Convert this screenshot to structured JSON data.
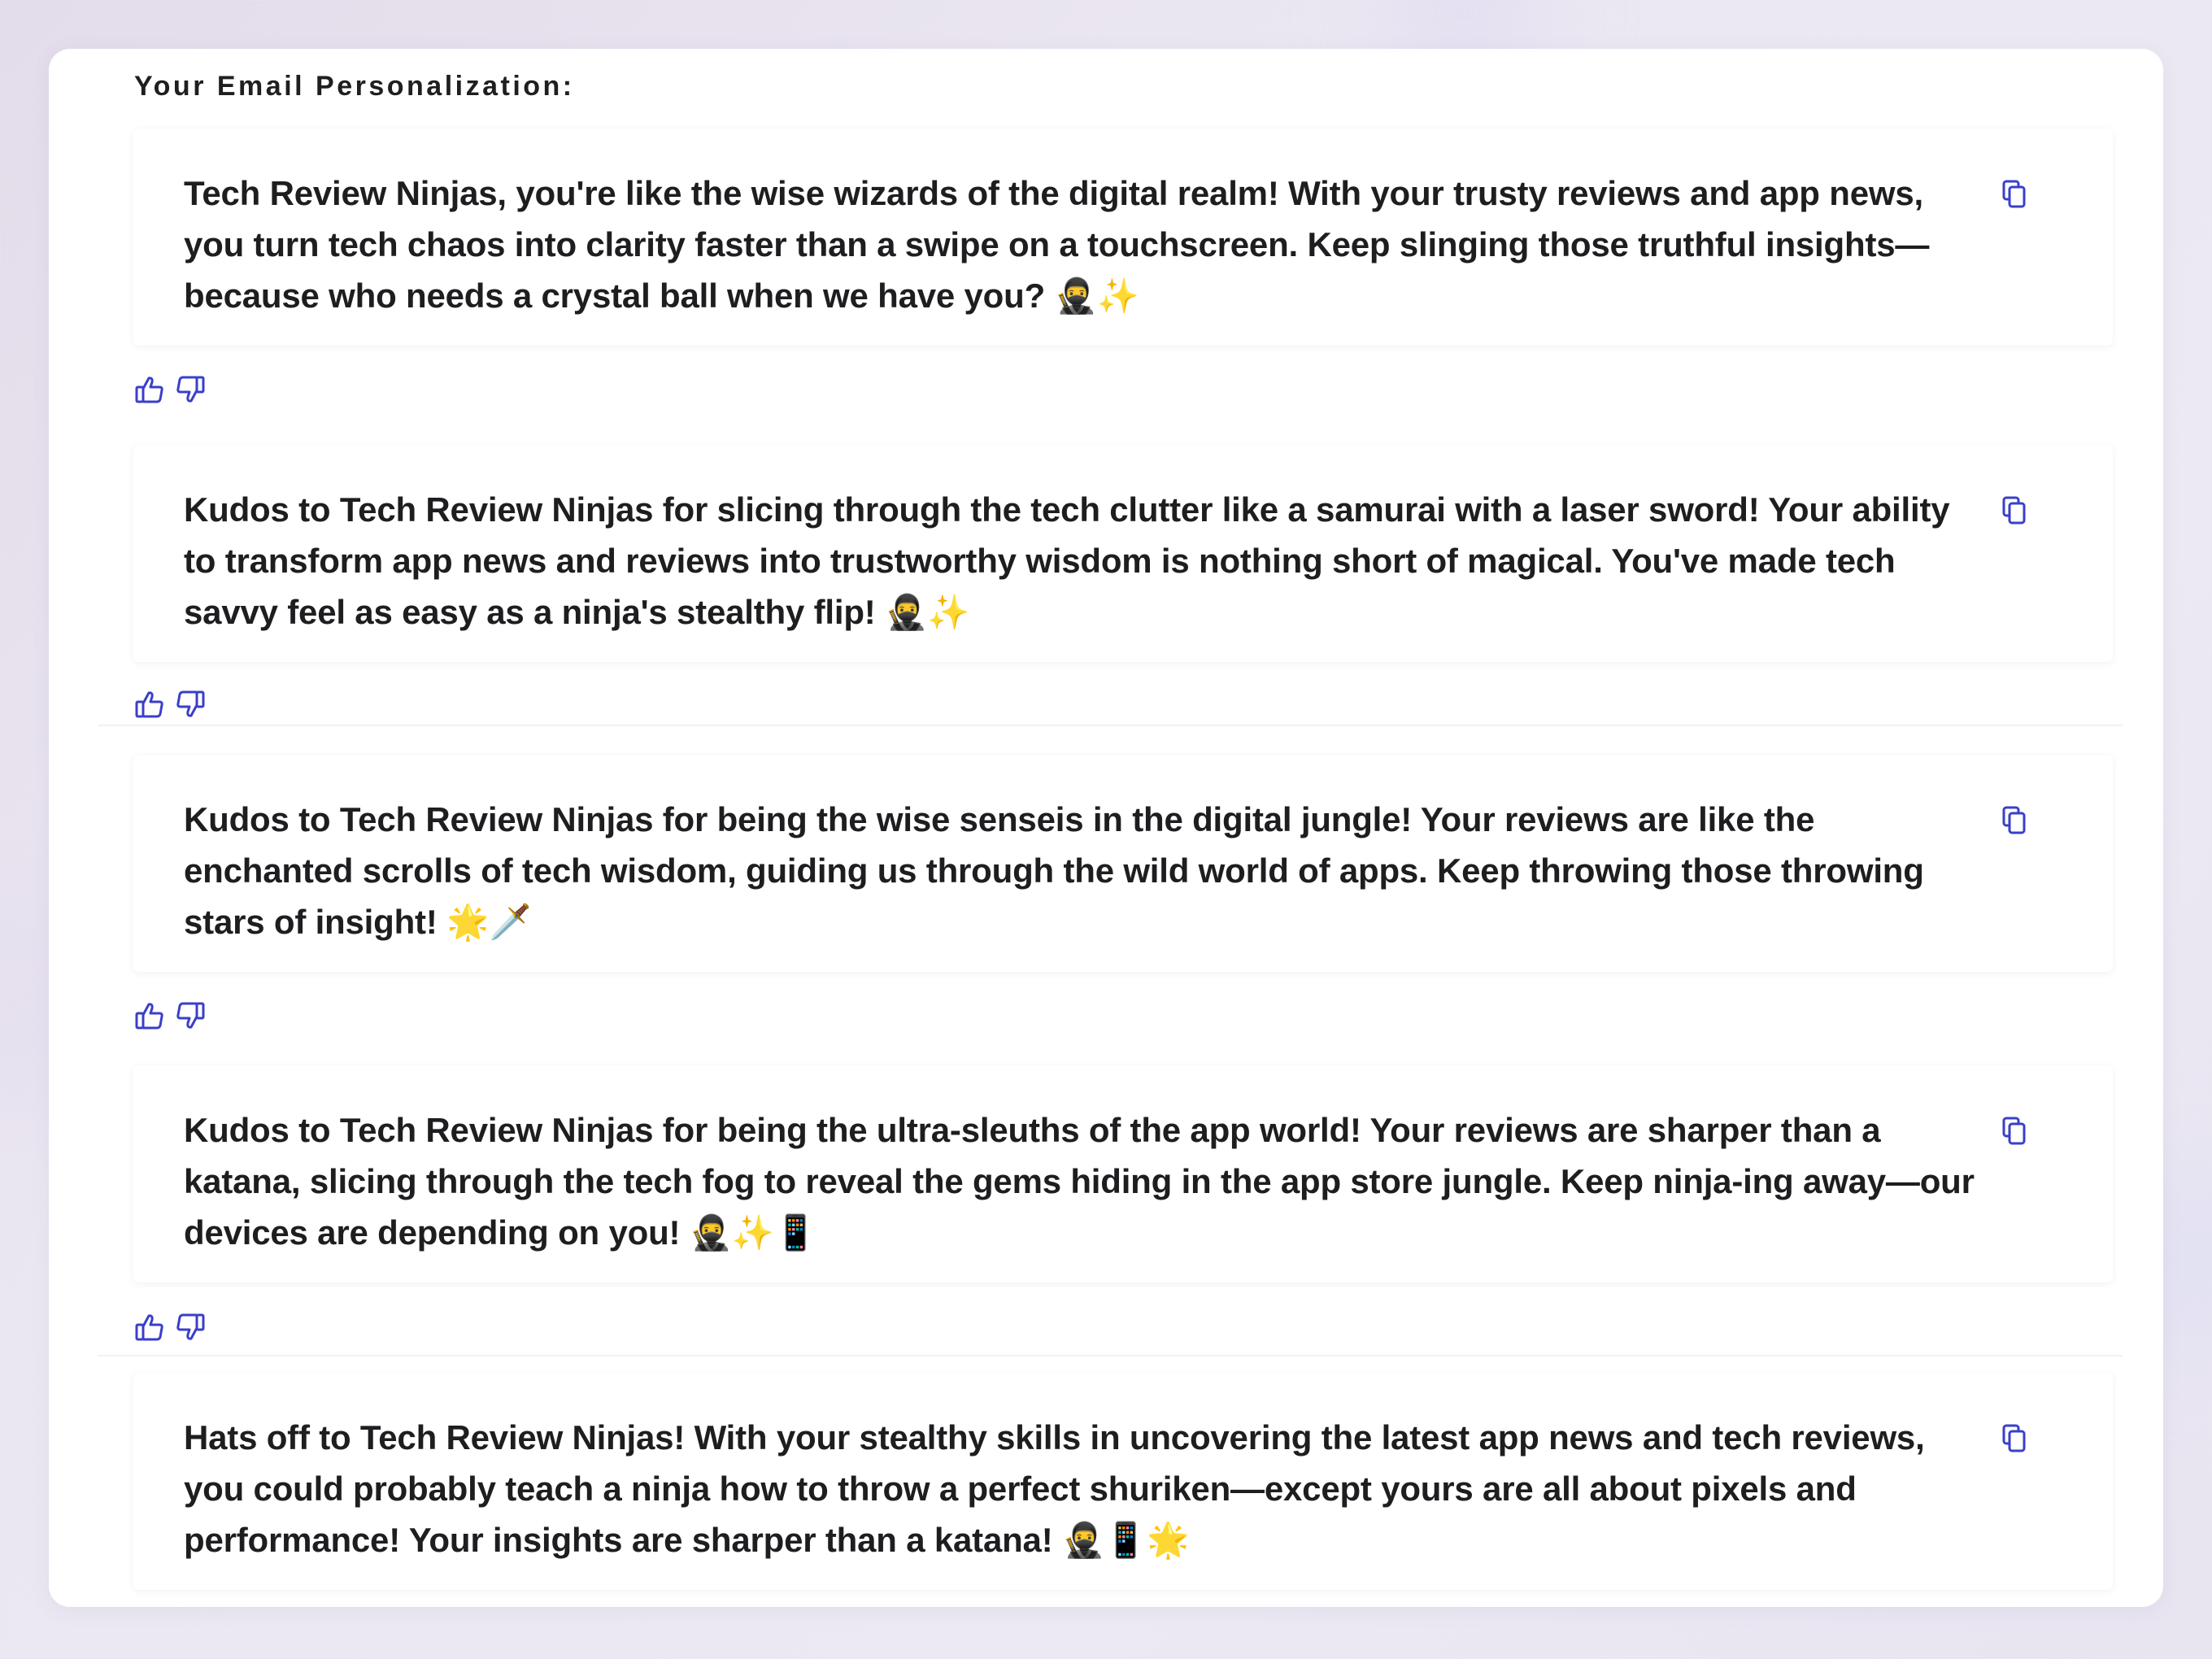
{
  "section_title": "Your Email Personalization:",
  "colors": {
    "icon_accent": "#3a3fc9",
    "text": "#1e1e21"
  },
  "icons": {
    "copy": "copy-icon",
    "like": "thumbs-up-icon",
    "dislike": "thumbs-down-icon"
  },
  "personalizations": [
    {
      "text": "Tech Review Ninjas, you're like the wise wizards of the digital realm! With your trusty reviews and app news, you turn tech chaos into clarity faster than a swipe on a touchscreen. Keep slinging those truthful insights—because who needs a crystal ball when we have you? 🥷✨"
    },
    {
      "text": "Kudos to Tech Review Ninjas for slicing through the tech clutter like a samurai with a laser sword! Your ability to transform app news and reviews into trustworthy wisdom is nothing short of magical. You've made tech savvy feel as easy as a ninja's stealthy flip! 🥷✨"
    },
    {
      "text": "Kudos to Tech Review Ninjas for being the wise senseis in the digital jungle! Your reviews are like the enchanted scrolls of tech wisdom, guiding us through the wild world of apps. Keep throwing those throwing stars of insight! 🌟🗡️"
    },
    {
      "text": "Kudos to Tech Review Ninjas for being the ultra-sleuths of the app world! Your reviews are sharper than a katana, slicing through the tech fog to reveal the gems hiding in the app store jungle. Keep ninja-ing away—our devices are depending on you! 🥷✨📱"
    },
    {
      "text": "Hats off to Tech Review Ninjas! With your stealthy skills in uncovering the latest app news and tech reviews, you could probably teach a ninja how to throw a perfect shuriken—except yours are all about pixels and performance! Your insights are sharper than a katana! 🥷📱🌟"
    }
  ]
}
